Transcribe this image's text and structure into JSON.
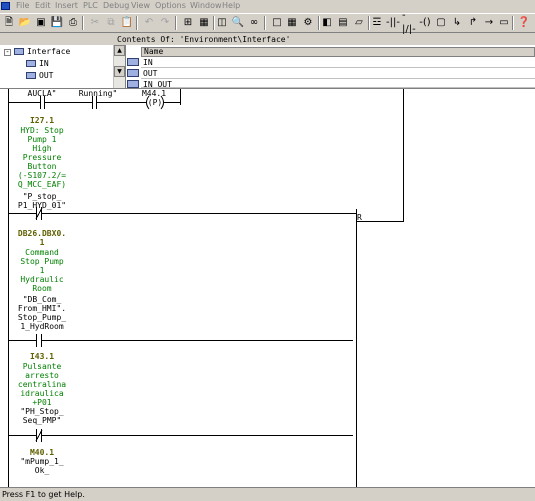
{
  "menu": [
    "File",
    "Edit",
    "Insert",
    "PLC",
    "Debug",
    "View",
    "Options",
    "Window",
    "Help"
  ],
  "contents_title": "Contents Of: 'Environment\\Interface'",
  "tree": {
    "root": "Interface",
    "items": [
      "IN",
      "OUT"
    ]
  },
  "detail": {
    "header": "Name",
    "rows": [
      "IN",
      "OUT",
      "IN_OUT"
    ]
  },
  "network": {
    "top": {
      "left_symbol": "AUCLA\"",
      "mid_symbol": "Running\"",
      "coil_addr": "M44.1",
      "coil_type": "(P)"
    },
    "contacts": [
      {
        "address": "I27.1",
        "comment": "HYD: Stop\nPump 1\nHigh\nPressure\nButton\n(-S107.2/=\nQ_MCC_EAF)",
        "symbol": "\"P_stop_\nP1_HYD_01\""
      },
      {
        "address": "DB26.DBX0.\n1",
        "comment": "Command\nStop Pump\n1\nHydraulic\nRoom",
        "symbol": "\"DB_Com_\nFrom_HMI\".\nStop_Pump_\n1_HydRoom"
      },
      {
        "address": "I43.1",
        "comment": "Pulsante\narresto\ncentralina\nidraulica\n+P01",
        "symbol": "\"PH_Stop_\nSeq_PMP\""
      },
      {
        "address": "M40.1",
        "comment": "",
        "symbol": "\"mPump_1_\nOk_"
      }
    ],
    "reset_label": "R"
  },
  "status_text": "Press F1 to get Help."
}
